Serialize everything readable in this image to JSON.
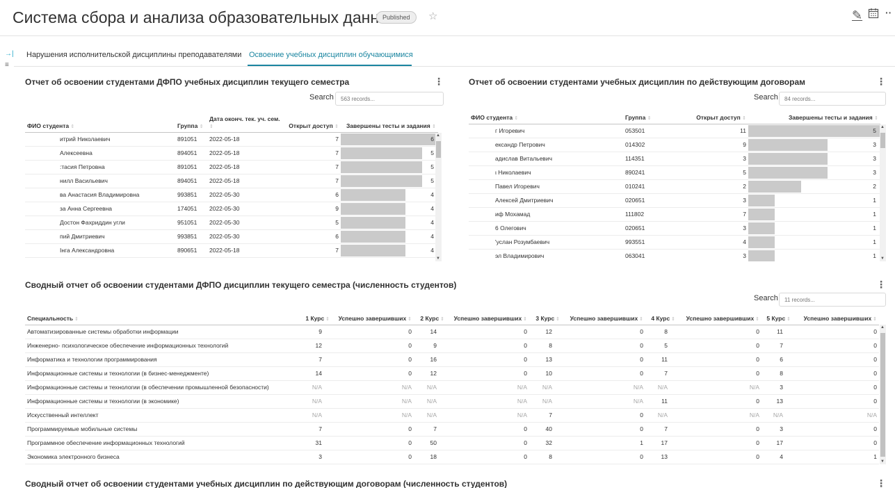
{
  "header": {
    "title": "Система сбора и анализа образовательных данных",
    "status_badge": "Published"
  },
  "tabs": [
    {
      "label": "Нарушения исполнительской дисциплины преподавателями"
    },
    {
      "label": "Освоение учебных дисциплин обучающимися"
    }
  ],
  "panel1": {
    "title": "Отчет об освоении студентами ДФПО учебных дисциплин текущего семестра",
    "search_label": "Search",
    "search_placeholder": "563 records...",
    "columns": [
      "ФИО студента",
      "Группа",
      "Дата оконч. тек. уч. сем.",
      "Открыт доступ",
      "Завершены тесты и задания"
    ],
    "rows": [
      {
        "name": "итрий Николаевич",
        "group": "891051",
        "date": "2022-05-18",
        "access": "7",
        "done": 6
      },
      {
        "name": "Алексеевна",
        "group": "894051",
        "date": "2022-05-18",
        "access": "7",
        "done": 5
      },
      {
        "name": ":тасия Петровна",
        "group": "891051",
        "date": "2022-05-18",
        "access": "7",
        "done": 5
      },
      {
        "name": "нилл Васильевич",
        "group": "894051",
        "date": "2022-05-18",
        "access": "7",
        "done": 5
      },
      {
        "name": "ва Анастасия Владимировна",
        "group": "993851",
        "date": "2022-05-30",
        "access": "6",
        "done": 4
      },
      {
        "name": "за Анна Сергеевна",
        "group": "174051",
        "date": "2022-05-30",
        "access": "9",
        "done": 4
      },
      {
        "name": "Достон Фахриддин угли",
        "group": "951051",
        "date": "2022-05-30",
        "access": "5",
        "done": 4
      },
      {
        "name": "пий Дмитриевич",
        "group": "993851",
        "date": "2022-05-30",
        "access": "6",
        "done": 4
      },
      {
        "name": "Інга Александровна",
        "group": "890651",
        "date": "2022-05-18",
        "access": "7",
        "done": 4
      }
    ]
  },
  "panel2": {
    "title": "Отчет об освоении студентами учебных дисциплин по действующим договорам",
    "search_label": "Search",
    "search_placeholder": "84 records...",
    "columns": [
      "ФИО студента",
      "Группа",
      "Открыт доступ",
      "Завершены тесты и задания"
    ],
    "rows": [
      {
        "name": "г Игоревич",
        "group": "053501",
        "access": "11",
        "done": 5
      },
      {
        "name": "ександр Петрович",
        "group": "014302",
        "access": "9",
        "done": 3
      },
      {
        "name": "адислав Витальевич",
        "group": "114351",
        "access": "3",
        "done": 3
      },
      {
        "name": "ι Николаевич",
        "group": "890241",
        "access": "5",
        "done": 3
      },
      {
        "name": "Павел Игоревич",
        "group": "010241",
        "access": "2",
        "done": 2
      },
      {
        "name": "Алексей Дмитриевич",
        "group": "020651",
        "access": "3",
        "done": 1
      },
      {
        "name": "иф Мохамад",
        "group": "111802",
        "access": "7",
        "done": 1
      },
      {
        "name": "6 Олегович",
        "group": "020651",
        "access": "3",
        "done": 1
      },
      {
        "name": "'услан Розумбаевич",
        "group": "993551",
        "access": "4",
        "done": 1
      },
      {
        "name": "эл Владимирович",
        "group": "063041",
        "access": "3",
        "done": 1
      }
    ]
  },
  "panel3": {
    "title": "Сводный отчет об освоении студентами ДФПО дисциплин текущего семестра (численность студентов)",
    "search_label": "Search",
    "search_placeholder": "11 records...",
    "columns": [
      "Специальность",
      "1 Курс",
      "Успешно завершивших",
      "2 Курс",
      "Успешно завершивших",
      "3 Курс",
      "Успешно завершивших",
      "4 Курс",
      "Успешно завершивших",
      "5 Курс",
      "Успешно завершивших"
    ],
    "rows": [
      [
        "Автоматизированные системы обработки информации",
        "9",
        "0",
        "14",
        "0",
        "12",
        "0",
        "8",
        "0",
        "11",
        "0"
      ],
      [
        "Инженерно- психологическое обеспечение информационных технологий",
        "12",
        "0",
        "9",
        "0",
        "8",
        "0",
        "5",
        "0",
        "7",
        "0"
      ],
      [
        "Информатика и технологии программирования",
        "7",
        "0",
        "16",
        "0",
        "13",
        "0",
        "11",
        "0",
        "6",
        "0"
      ],
      [
        "Информационные системы и технологии (в бизнес-менеджменте)",
        "14",
        "0",
        "12",
        "0",
        "10",
        "0",
        "7",
        "0",
        "8",
        "0"
      ],
      [
        "Информационные системы и технологии (в обеспечении промышленной безопасности)",
        "N/A",
        "N/A",
        "N/A",
        "N/A",
        "N/A",
        "N/A",
        "N/A",
        "N/A",
        "3",
        "0"
      ],
      [
        "Информационные системы и технологии (в экономике)",
        "N/A",
        "N/A",
        "N/A",
        "N/A",
        "N/A",
        "N/A",
        "11",
        "0",
        "13",
        "0"
      ],
      [
        "Искусственный интеллект",
        "N/A",
        "N/A",
        "N/A",
        "N/A",
        "7",
        "0",
        "N/A",
        "N/A",
        "N/A",
        "N/A"
      ],
      [
        "Программируемые мобильные системы",
        "7",
        "0",
        "7",
        "0",
        "40",
        "0",
        "7",
        "0",
        "3",
        "0"
      ],
      [
        "Программное обеспечение информационных технологий",
        "31",
        "0",
        "50",
        "0",
        "32",
        "1",
        "17",
        "0",
        "17",
        "0"
      ],
      [
        "Экономика электронного бизнеса",
        "3",
        "0",
        "18",
        "0",
        "8",
        "0",
        "13",
        "0",
        "4",
        "1"
      ]
    ]
  },
  "panel4": {
    "title": "Сводный отчет об освоении студентами учебных дисциплин по действующим договорам (численность студентов)"
  },
  "icons": {
    "edit": "pencil-icon",
    "calendar": "calendar-icon",
    "more": "more-horizontal-icon",
    "star": "star-icon"
  },
  "colors": {
    "accent": "#1a85a0",
    "bar": "#cacaca",
    "na_text": "#a8a8a8"
  }
}
